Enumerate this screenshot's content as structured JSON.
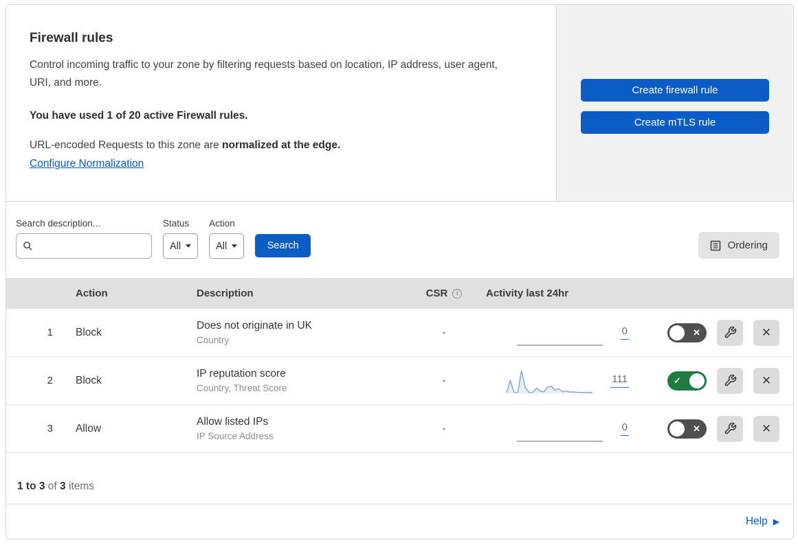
{
  "hero": {
    "title": "Firewall rules",
    "description": "Control incoming traffic to your zone by filtering requests based on location, IP address, user agent, URI, and more.",
    "usage_bold": "You have used 1 of 20 active Firewall rules.",
    "normalization_text": "URL-encoded Requests to this zone are ",
    "normalization_bold": "normalized at the edge.",
    "normalization_link": "Configure Normalization",
    "create_firewall_button": "Create firewall rule",
    "create_mtls_button": "Create mTLS rule"
  },
  "filters": {
    "search_label": "Search description...",
    "search_value": "",
    "status_label": "Status",
    "status_value": "All",
    "action_label": "Action",
    "action_value": "All",
    "search_button": "Search",
    "ordering_button": "Ordering"
  },
  "table": {
    "headers": {
      "action": "Action",
      "description": "Description",
      "csr": "CSR",
      "activity": "Activity last 24hr"
    },
    "rows": [
      {
        "index": "1",
        "action": "Block",
        "description": "Does not originate in UK",
        "criteria": "Country",
        "csr": "-",
        "activity_count": "0",
        "enabled": false,
        "sparkline": [
          0,
          0,
          0,
          0,
          0,
          0,
          0,
          0,
          0,
          0,
          0,
          0,
          0,
          0,
          0,
          0,
          0,
          0,
          0,
          0,
          0,
          0,
          0,
          0
        ]
      },
      {
        "index": "2",
        "action": "Block",
        "description": "IP reputation score",
        "criteria": "Country, Threat Score",
        "csr": "-",
        "activity_count": "111",
        "enabled": true,
        "sparkline": [
          2,
          55,
          5,
          3,
          100,
          25,
          4,
          4,
          22,
          10,
          6,
          28,
          30,
          14,
          20,
          6,
          10,
          5,
          6,
          4,
          4,
          3,
          3,
          3
        ]
      },
      {
        "index": "3",
        "action": "Allow",
        "description": "Allow listed IPs",
        "criteria": "IP Source Address",
        "csr": "-",
        "activity_count": "0",
        "enabled": false,
        "sparkline": [
          0,
          0,
          0,
          0,
          0,
          0,
          0,
          0,
          0,
          0,
          0,
          0,
          0,
          0,
          0,
          0,
          0,
          0,
          0,
          0,
          0,
          0,
          0,
          0
        ]
      }
    ]
  },
  "footer": {
    "range": "1 to 3",
    "of": "of",
    "total": "3",
    "items": "items",
    "help": "Help"
  },
  "icons": {
    "info": "i",
    "close": "✕",
    "check": "✓",
    "help_arrow": "▶"
  },
  "colors": {
    "accent_blue": "#0b5cc4",
    "toggle_on_green": "#1e7b41",
    "toggle_off_gray": "#4f4f4f",
    "sparkline_blue": "#7ba3e0",
    "sparkline_flat_gray": "#9a9a9a",
    "hero_panel_gray": "#f1f1f1",
    "table_header_gray": "#e0e0e0"
  }
}
